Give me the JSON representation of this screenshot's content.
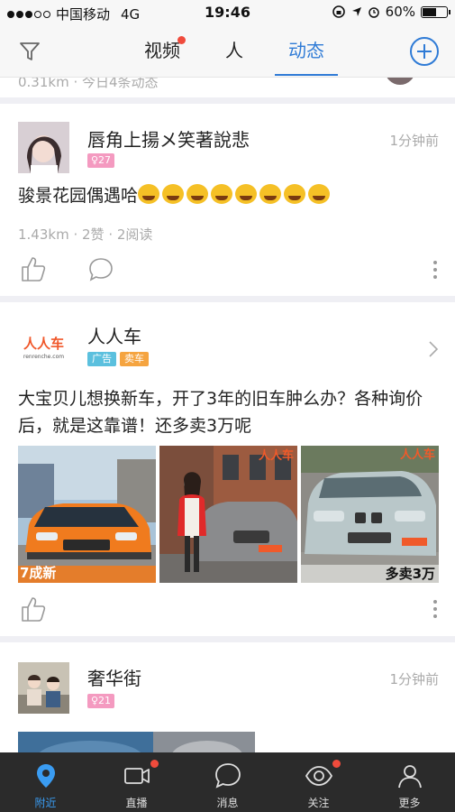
{
  "status_bar": {
    "carrier": "中国移动",
    "network": "4G",
    "time": "19:46",
    "battery": "60%",
    "battery_level": 0.6,
    "signal_bars": 3,
    "signal_total": 5
  },
  "nav": {
    "tabs": [
      {
        "label": "视频",
        "badge": true
      },
      {
        "label": "人",
        "badge": false
      },
      {
        "label": "动态",
        "badge": false,
        "active": true
      }
    ],
    "accent": "#2f7bd6"
  },
  "peek": {
    "text": "0.31km · 今日4条动态"
  },
  "post1": {
    "name": "唇角上揚メ笑著說悲",
    "badge": "♀27",
    "time": "1分钟前",
    "text": "骏景花园偶遇哈",
    "emoji_count": 8,
    "meta": "1.43km · 2赞 · 2阅读"
  },
  "ad": {
    "name": "人人车",
    "logo_text": "人人车",
    "logo_sub": "renrenche.com",
    "tags": [
      "广告",
      "卖车"
    ],
    "text": "大宝贝儿想换新车，开了3年的旧车肿么办？各种询价后，就是这靠谱！还多卖3万呢",
    "photos": [
      {
        "caption": "7成新",
        "watermark": ""
      },
      {
        "caption": "",
        "watermark": "人人车"
      },
      {
        "caption": "多卖3万",
        "watermark": "人人车"
      }
    ]
  },
  "post2": {
    "name": "奢华街",
    "badge": "♀21",
    "time": "1分钟前"
  },
  "bottom_tabs": [
    {
      "label": "附近",
      "icon": "location-pin-icon",
      "active": true,
      "badge": false
    },
    {
      "label": "直播",
      "icon": "video-camera-icon",
      "active": false,
      "badge": true
    },
    {
      "label": "消息",
      "icon": "chat-bubble-icon",
      "active": false,
      "badge": false
    },
    {
      "label": "关注",
      "icon": "eye-icon",
      "active": false,
      "badge": true
    },
    {
      "label": "更多",
      "icon": "person-icon",
      "active": false,
      "badge": false
    }
  ]
}
